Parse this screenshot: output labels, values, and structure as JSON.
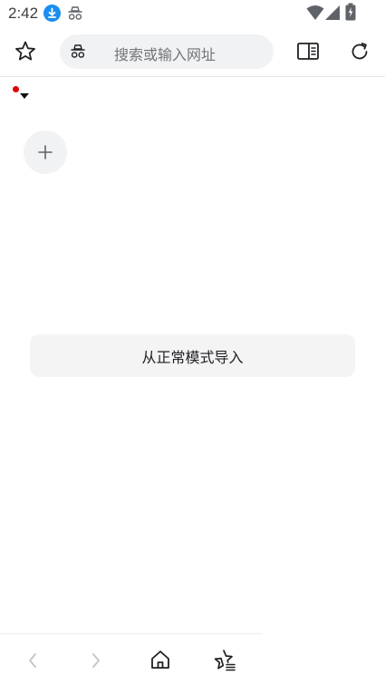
{
  "status_bar": {
    "time": "2:42",
    "icons": [
      "download-icon",
      "incognito-icon",
      "wifi-icon",
      "signal-icon",
      "battery-icon"
    ]
  },
  "toolbar": {
    "search_placeholder": "搜索或输入网址",
    "icons": [
      "star-icon",
      "incognito-icon",
      "reader-mode-icon",
      "reload-icon"
    ]
  },
  "tab_group": {
    "has_new_indicator": true,
    "indicator_color": "#e00000"
  },
  "main": {
    "add_button_icon": "plus-icon",
    "import_button_label": "从正常模式导入"
  },
  "bottom_bar": {
    "icons": [
      "back-icon",
      "forward-icon",
      "home-icon",
      "bookmarks-icon"
    ]
  },
  "colors": {
    "accent": "#1a8ef0",
    "search_bg": "#f1f2f3",
    "button_bg": "#f4f4f5"
  }
}
